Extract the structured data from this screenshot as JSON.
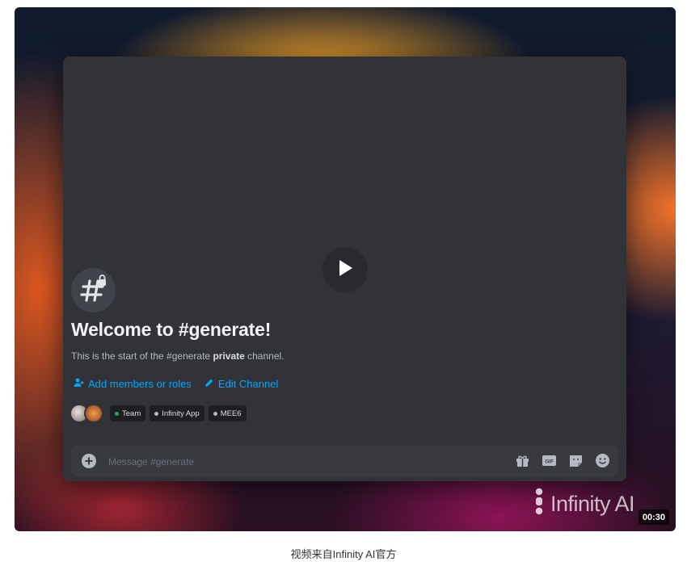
{
  "channel": {
    "welcome_title": "Welcome to #generate!",
    "description_prefix": "This is the start of the #generate ",
    "description_bold": "private",
    "description_suffix": " channel."
  },
  "actions": {
    "add_members": "Add members or roles",
    "edit_channel": "Edit Channel"
  },
  "member_tags": [
    {
      "label": "Team",
      "dot_color": "#23a55a"
    },
    {
      "label": "Infinity App",
      "dot_color": "#b5bac1"
    },
    {
      "label": "MEE6",
      "dot_color": "#b5bac1"
    }
  ],
  "composer": {
    "placeholder": "Message #generate"
  },
  "video": {
    "watermark": "Infinity AI",
    "duration": "00:30"
  },
  "caption": "视频来自Infinity AI官方",
  "colors": {
    "link": "#00a8fc",
    "background": "#313338",
    "composer": "#383a40"
  }
}
